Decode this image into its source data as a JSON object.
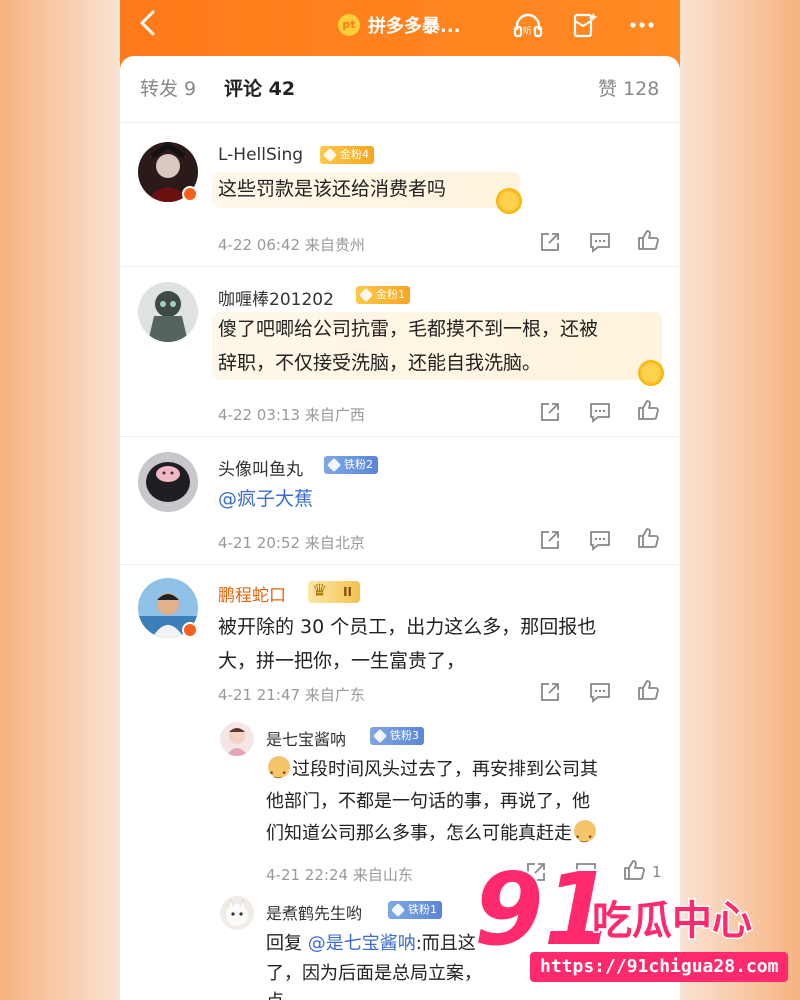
{
  "header": {
    "title": "拼多多暴...",
    "app_logo_text": "pt",
    "icons": [
      "back-icon",
      "listen-icon",
      "red-packet-icon",
      "more-icon"
    ]
  },
  "tabs": {
    "repost": "转发 9",
    "comment": "评论 42",
    "like": "赞 128"
  },
  "comments": [
    {
      "user": "L-HellSing",
      "badge": "金粉4",
      "text": "这些罚款是该还给消费者吗",
      "time": "4-22 06:42",
      "location": "来自贵州"
    },
    {
      "user": "咖喱棒201202",
      "badge": "金粉1",
      "text1": "傻了吧唧给公司抗雷，毛都摸不到一根，还被",
      "text2": "辞职，不仅接受洗脑，还能自我洗脑。",
      "time": "4-22 03:13",
      "location": "来自广西"
    },
    {
      "user": "头像叫鱼丸",
      "badge": "铁粉2",
      "text": "@疯子大蕉",
      "time": "4-21 20:52",
      "location": "来自北京"
    },
    {
      "user": "鹏程蛇口",
      "badge": "II",
      "text1": "被开除的 30 个员工，出力这么多，那回报也",
      "text2": "大，拼一把你，一生富贵了，",
      "time": "4-21 21:47",
      "location": "来自广东"
    }
  ],
  "replies": [
    {
      "user": "是七宝酱呐",
      "badge": "铁粉3",
      "text1": "过段时间风头过去了，再安排到公司其",
      "text2": "他部门，不都是一句话的事，再说了，他",
      "text3": "们知道公司那么多事，怎么可能真赶走",
      "time": "4-21 22:24",
      "location": "来自山东",
      "likes": "1"
    },
    {
      "user": "是煮鹤先生哟",
      "badge": "铁粉1",
      "reply_prefix": "回复",
      "mention": "@是七宝酱呐",
      "text1": ":而且这",
      "text2": "了，因为后面是总局立案，",
      "text3": "点，"
    }
  ],
  "watermark": {
    "number": "91",
    "name": "吃瓜中心",
    "url": "https://91chigua28.com"
  },
  "colors": {
    "accent": "#ff7a1a",
    "mention": "#3b6ccf",
    "watermark": "#ff2a6d"
  }
}
